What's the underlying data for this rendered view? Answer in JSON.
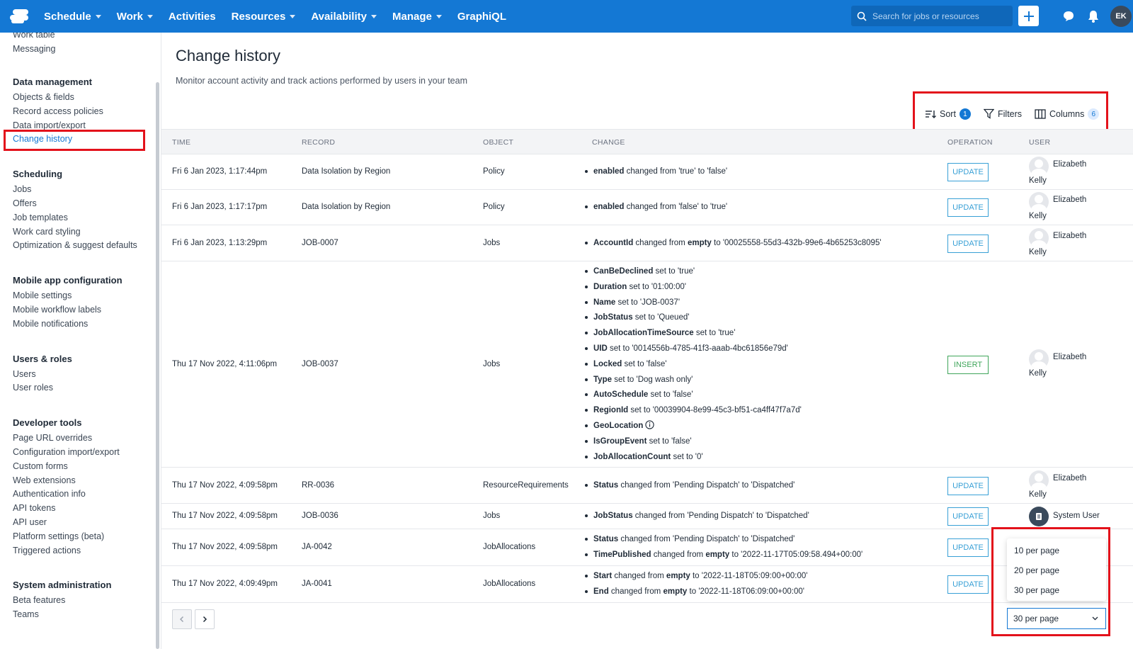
{
  "nav": {
    "items": [
      {
        "label": "Schedule",
        "dropdown": true
      },
      {
        "label": "Work",
        "dropdown": true
      },
      {
        "label": "Activities",
        "dropdown": false
      },
      {
        "label": "Resources",
        "dropdown": true
      },
      {
        "label": "Availability",
        "dropdown": true
      },
      {
        "label": "Manage",
        "dropdown": true
      },
      {
        "label": "GraphiQL",
        "dropdown": false
      }
    ],
    "search_placeholder": "Search for jobs or resources",
    "user_initials": "EK"
  },
  "sidebar": {
    "top_items": [
      "Work table",
      "Messaging"
    ],
    "groups": [
      {
        "title": "Data management",
        "items": [
          "Objects & fields",
          "Record access policies",
          "Data import/export",
          "Change history"
        ]
      },
      {
        "title": "Scheduling",
        "items": [
          "Jobs",
          "Offers",
          "Job templates",
          "Work card styling",
          "Optimization & suggest defaults"
        ]
      },
      {
        "title": "Mobile app configuration",
        "items": [
          "Mobile settings",
          "Mobile workflow labels",
          "Mobile notifications"
        ]
      },
      {
        "title": "Users & roles",
        "items": [
          "Users",
          "User roles"
        ]
      },
      {
        "title": "Developer tools",
        "items": [
          "Page URL overrides",
          "Configuration import/export",
          "Custom forms",
          "Web extensions",
          "Authentication info",
          "API tokens",
          "API user",
          "Platform settings (beta)",
          "Triggered actions"
        ]
      },
      {
        "title": "System administration",
        "items": [
          "Beta features",
          "Teams"
        ]
      }
    ],
    "active": "Change history"
  },
  "page": {
    "title": "Change history",
    "subtitle": "Monitor account activity and track actions performed by users in your team"
  },
  "toolbar": {
    "sort_label": "Sort",
    "sort_count": "1",
    "filters_label": "Filters",
    "columns_label": "Columns",
    "columns_count": "6"
  },
  "table": {
    "headers": [
      "TIME",
      "RECORD",
      "OBJECT",
      "CHANGE",
      "OPERATION",
      "USER"
    ],
    "rows": [
      {
        "time": "Fri 6 Jan 2023, 1:17:44pm",
        "record": "Data Isolation by Region",
        "object": "Policy",
        "operation": "UPDATE",
        "user_first": "Elizabeth",
        "user_last": "Kelly",
        "changes": [
          {
            "field": "enabled",
            "verb": " changed from ",
            "from": "'true'",
            "to_word": " to ",
            "to": "'false'"
          }
        ]
      },
      {
        "time": "Fri 6 Jan 2023, 1:17:17pm",
        "record": "Data Isolation by Region",
        "object": "Policy",
        "operation": "UPDATE",
        "user_first": "Elizabeth",
        "user_last": "Kelly",
        "changes": [
          {
            "field": "enabled",
            "verb": " changed from ",
            "from": "'false'",
            "to_word": " to ",
            "to": "'true'"
          }
        ]
      },
      {
        "time": "Fri 6 Jan 2023, 1:13:29pm",
        "record": "JOB-0007",
        "object": "Jobs",
        "operation": "UPDATE",
        "user_first": "Elizabeth",
        "user_last": "Kelly",
        "changes": [
          {
            "field": "AccountId",
            "verb": " changed from ",
            "from": "empty",
            "to_word": " to ",
            "to": "'00025558-55d3-432b-99e6-4b65253c8095'"
          }
        ]
      },
      {
        "time": "Thu 17 Nov 2022, 4:11:06pm",
        "record": "JOB-0037",
        "object": "Jobs",
        "operation": "INSERT",
        "user_first": "Elizabeth",
        "user_last": "Kelly",
        "changes": [
          {
            "field": "CanBeDeclined",
            "verb": " set to ",
            "from": "'true'"
          },
          {
            "field": "Duration",
            "verb": " set to ",
            "from": "'01:00:00'"
          },
          {
            "field": "Name",
            "verb": " set to ",
            "from": "'JOB-0037'"
          },
          {
            "field": "JobStatus",
            "verb": " set to ",
            "from": "'Queued'"
          },
          {
            "field": "JobAllocationTimeSource",
            "verb": " set to ",
            "from": "'true'"
          },
          {
            "field": "UID",
            "verb": " set to ",
            "from": "'0014556b-4785-41f3-aaab-4bc61856e79d'"
          },
          {
            "field": "Locked",
            "verb": " set to ",
            "from": "'false'"
          },
          {
            "field": "Type",
            "verb": " set to ",
            "from": "'Dog wash only'"
          },
          {
            "field": "AutoSchedule",
            "verb": " set to ",
            "from": "'false'"
          },
          {
            "field": "RegionId",
            "verb": " set to ",
            "from": "'00039904-8e99-45c3-bf51-ca4ff47f7a7d'"
          },
          {
            "field": "GeoLocation",
            "verb": "",
            "from": "",
            "info": true
          },
          {
            "field": "IsGroupEvent",
            "verb": " set to ",
            "from": "'false'"
          },
          {
            "field": "JobAllocationCount",
            "verb": " set to ",
            "from": "'0'"
          }
        ]
      },
      {
        "time": "Thu 17 Nov 2022, 4:09:58pm",
        "record": "RR-0036",
        "object": "ResourceRequirements",
        "operation": "UPDATE",
        "user_first": "Elizabeth",
        "user_last": "Kelly",
        "changes": [
          {
            "field": "Status",
            "verb": " changed from ",
            "from": "'Pending Dispatch'",
            "to_word": " to ",
            "to": "'Dispatched'"
          }
        ]
      },
      {
        "time": "Thu 17 Nov 2022, 4:09:58pm",
        "record": "JOB-0036",
        "object": "Jobs",
        "operation": "UPDATE",
        "user_first": "System User",
        "user_last": "",
        "changes": [
          {
            "field": "JobStatus",
            "verb": " changed from ",
            "from": "'Pending Dispatch'",
            "to_word": " to ",
            "to": "'Dispatched'"
          }
        ]
      },
      {
        "time": "Thu 17 Nov 2022, 4:09:58pm",
        "record": "JA-0042",
        "object": "JobAllocations",
        "operation": "UPDATE",
        "user_first": "",
        "user_last": "",
        "changes": [
          {
            "field": "Status",
            "verb": " changed from ",
            "from": "'Pending Dispatch'",
            "to_word": " to ",
            "to": "'Dispatched'"
          },
          {
            "field": "TimePublished",
            "verb": " changed from ",
            "from": "empty",
            "to_word": " to ",
            "to": "'2022-11-17T05:09:58.494+00:00'"
          }
        ]
      },
      {
        "time": "Thu 17 Nov 2022, 4:09:49pm",
        "record": "JA-0041",
        "object": "JobAllocations",
        "operation": "UPDATE",
        "user_first": "",
        "user_last": "",
        "changes": [
          {
            "field": "Start",
            "verb": " changed from ",
            "from": "empty",
            "to_word": " to ",
            "to": "'2022-11-18T05:09:00+00:00'"
          },
          {
            "field": "End",
            "verb": " changed from ",
            "from": "empty",
            "to_word": " to ",
            "to": "'2022-11-18T06:09:00+00:00'"
          }
        ]
      }
    ]
  },
  "pagination": {
    "options": [
      "10 per page",
      "20 per page",
      "30 per page"
    ],
    "selected": "30 per page"
  },
  "colors": {
    "primary": "#1478d4",
    "highlight": "#e3121b",
    "update": "#38a0d6",
    "insert": "#3fa55a"
  }
}
